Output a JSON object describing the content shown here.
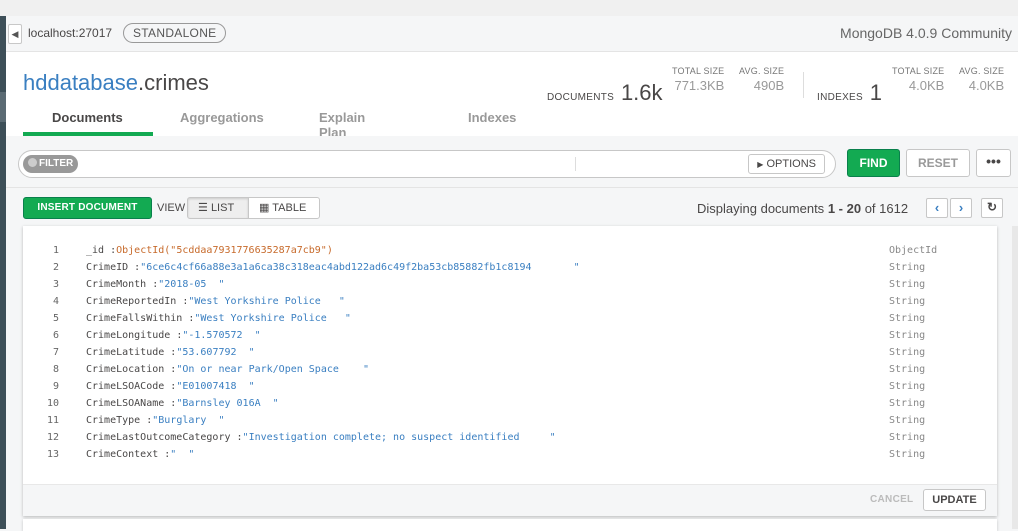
{
  "header": {
    "host": "localhost:27017",
    "badge": "STANDALONE",
    "version": "MongoDB 4.0.9 Community"
  },
  "collection": {
    "db": "hddatabase",
    "sep": ".",
    "name": "crimes",
    "documents_label": "DOCUMENTS",
    "documents_count": "1.6k",
    "total_size_label": "TOTAL SIZE",
    "total_size": "771.3KB",
    "avg_size_label": "AVG. SIZE",
    "avg_size": "490B",
    "indexes_label": "INDEXES",
    "indexes_count": "1",
    "idx_total_size_label": "TOTAL SIZE",
    "idx_total_size": "4.0KB",
    "idx_avg_size_label": "AVG. SIZE",
    "idx_avg_size": "4.0KB"
  },
  "tabs": [
    {
      "label": "Documents"
    },
    {
      "label": "Aggregations"
    },
    {
      "label": "Explain Plan"
    },
    {
      "label": "Indexes"
    }
  ],
  "toolbar": {
    "filter_label": "FILTER",
    "filter_value": "",
    "options_label": "OPTIONS",
    "find_label": "FIND",
    "reset_label": "RESET",
    "more_label": "•••"
  },
  "actions": {
    "insert_label": "INSERT DOCUMENT",
    "view_label": "VIEW",
    "list_label": "LIST",
    "table_label": "TABLE",
    "display_prefix": "Displaying documents",
    "display_range": "1 - 20",
    "display_of": "of",
    "display_total": "1612"
  },
  "document": {
    "fields": [
      {
        "n": "1",
        "key": "_id",
        "val": "ObjectId(\"5cddaa7931776635287a7cb9\")",
        "type": "ObjectId",
        "kind": "oid"
      },
      {
        "n": "2",
        "key": "CrimeID",
        "val": "\"6ce6c4cf66a88e3a1a6ca38c318eac4abd122ad6c49f2ba53cb85882fb1c8194       \"",
        "type": "String",
        "kind": "str"
      },
      {
        "n": "3",
        "key": "CrimeMonth",
        "val": "\"2018-05  \"",
        "type": "String",
        "kind": "str"
      },
      {
        "n": "4",
        "key": "CrimeReportedIn",
        "val": "\"West Yorkshire Police   \"",
        "type": "String",
        "kind": "str"
      },
      {
        "n": "5",
        "key": "CrimeFallsWithin",
        "val": "\"West Yorkshire Police   \"",
        "type": "String",
        "kind": "str"
      },
      {
        "n": "6",
        "key": "CrimeLongitude",
        "val": "\"-1.570572  \"",
        "type": "String",
        "kind": "str"
      },
      {
        "n": "7",
        "key": "CrimeLatitude",
        "val": "\"53.607792  \"",
        "type": "String",
        "kind": "str"
      },
      {
        "n": "8",
        "key": "CrimeLocation",
        "val": "\"On or near Park/Open Space    \"",
        "type": "String",
        "kind": "str"
      },
      {
        "n": "9",
        "key": "CrimeLSOACode",
        "val": "\"E01007418  \"",
        "type": "String",
        "kind": "str"
      },
      {
        "n": "10",
        "key": "CrimeLSOAName",
        "val": "\"Barnsley 016A  \"",
        "type": "String",
        "kind": "str"
      },
      {
        "n": "11",
        "key": "CrimeType",
        "val": "\"Burglary  \"",
        "type": "String",
        "kind": "str"
      },
      {
        "n": "12",
        "key": "CrimeLastOutcomeCategory",
        "val": "\"Investigation complete; no suspect identified     \"",
        "type": "String",
        "kind": "str"
      },
      {
        "n": "13",
        "key": "CrimeContext",
        "val": "\"  \"",
        "type": "String",
        "kind": "str"
      }
    ],
    "cancel_label": "CANCEL",
    "update_label": "UPDATE"
  },
  "colors": {
    "accent_green": "#13aa52",
    "link_blue": "#3a7fc1",
    "oid_orange": "#c76a2b"
  }
}
